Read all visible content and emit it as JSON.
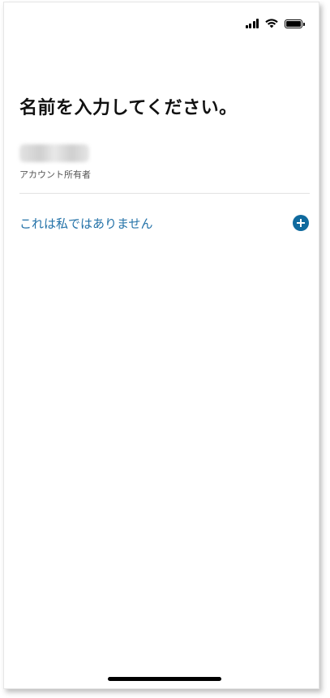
{
  "status_bar": {
    "signal_icon": "cellular-signal-icon",
    "wifi_icon": "wifi-icon",
    "battery_icon": "battery-icon"
  },
  "page": {
    "title": "名前を入力してください。",
    "owner_label": "アカウント所有者",
    "not_me_label": "これは私ではありません",
    "add_icon": "plus-circle-icon"
  },
  "colors": {
    "link": "#2372a8",
    "accent": "#0f6a9e"
  }
}
